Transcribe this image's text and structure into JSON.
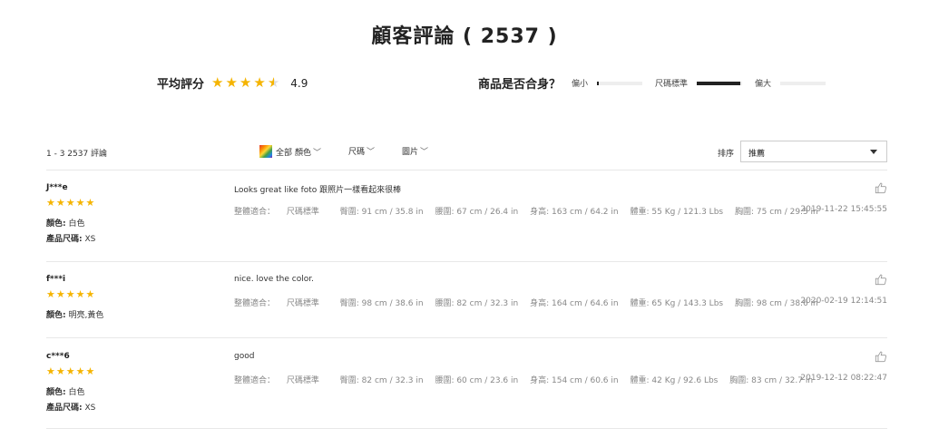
{
  "header": {
    "title": "顧客評論 ( 2537 )"
  },
  "summary": {
    "avg_label": "平均評分",
    "avg_value": "4.9",
    "avg_rating": 4.9,
    "fit_label": "商品是否合身？",
    "fit_options": [
      {
        "label": "偏小",
        "fraction": 0.04
      },
      {
        "label": "尺碼標準",
        "fraction": 0.95
      },
      {
        "label": "偏大",
        "fraction": 0.0
      }
    ]
  },
  "filters": {
    "count": "1 - 3 2537 評論",
    "all_colors": "全部",
    "color": "顏色",
    "size": "尺碼",
    "images": "圖片",
    "sort_label": "排序",
    "sort_value": "推薦"
  },
  "reviews": [
    {
      "user": "J***e",
      "rating": 5,
      "color_label": "顏色:",
      "color": "白色",
      "size_label": "產品尺碼:",
      "size": "XS",
      "comment": "Looks great like foto 跟照片一樣看起來很棒",
      "fit": "整體適合：",
      "fit_value": "尺碼標準",
      "hips": "臀圍: 91 cm / 35.8 in",
      "waist": "腰圍: 67 cm / 26.4 in",
      "height": "身高: 163 cm / 64.2 in",
      "weight": "體重: 55 Kg / 121.3 Lbs",
      "bust": "胸圍: 75 cm / 29.5 in",
      "date": "2019-11-22 15:45:55"
    },
    {
      "user": "f***i",
      "rating": 5,
      "color_label": "顏色:",
      "color": "明亮,黃色",
      "size_label": "",
      "size": "",
      "comment": "nice. love the color.",
      "fit": "整體適合：",
      "fit_value": "尺碼標準",
      "hips": "臀圍: 98 cm / 38.6 in",
      "waist": "腰圍: 82 cm / 32.3 in",
      "height": "身高: 164 cm / 64.6 in",
      "weight": "體重: 65 Kg / 143.3 Lbs",
      "bust": "胸圍: 98 cm / 38.6 in",
      "date": "2020-02-19 12:14:51"
    },
    {
      "user": "c***6",
      "rating": 5,
      "color_label": "顏色:",
      "color": "白色",
      "size_label": "產品尺碼:",
      "size": "XS",
      "comment": "good",
      "fit": "整體適合：",
      "fit_value": "尺碼標準",
      "hips": "臀圍: 82 cm / 32.3 in",
      "waist": "腰圍: 60 cm / 23.6 in",
      "height": "身高: 154 cm / 60.6 in",
      "weight": "體重: 42 Kg / 92.6 Lbs",
      "bust": "胸圍: 83 cm / 32.7 in",
      "date": "2019-12-12 08:22:47"
    }
  ],
  "colors": {
    "star": "#f5b400",
    "accent": "#222222",
    "muted": "#888888"
  },
  "icons": {
    "like": "thumbs-up-icon",
    "star": "star-icon",
    "caret": "caret-down-icon",
    "color_swatch": "rainbow-swatch-icon"
  }
}
